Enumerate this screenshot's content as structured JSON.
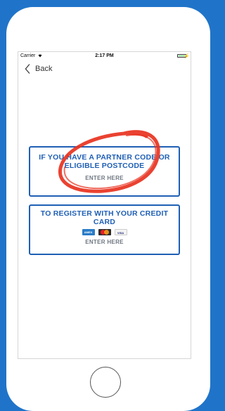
{
  "status_bar": {
    "carrier": "Carrier",
    "time": "2:17 PM",
    "wifi_icon": "wifi-icon",
    "battery_icon": "battery-icon",
    "battery_level": 1.0,
    "charging_icon": "charging-icon"
  },
  "nav": {
    "back_label": "Back",
    "back_icon": "chevron-left-icon"
  },
  "cards": [
    {
      "title": "IF YOU HAVE A PARTNER CODE OR ELIGIBLE POSTCODE",
      "cta": "ENTER HERE"
    },
    {
      "title": "TO REGISTER WITH YOUR CREDIT CARD",
      "cta": "ENTER HERE",
      "logos": [
        "AMEX",
        "mastercard",
        "VISA"
      ]
    }
  ],
  "colors": {
    "background": "#1f74c9",
    "card_border": "#1f5fb5",
    "card_title": "#1f5fb5",
    "annotation": "#e8321f",
    "battery": "#4cd964"
  }
}
